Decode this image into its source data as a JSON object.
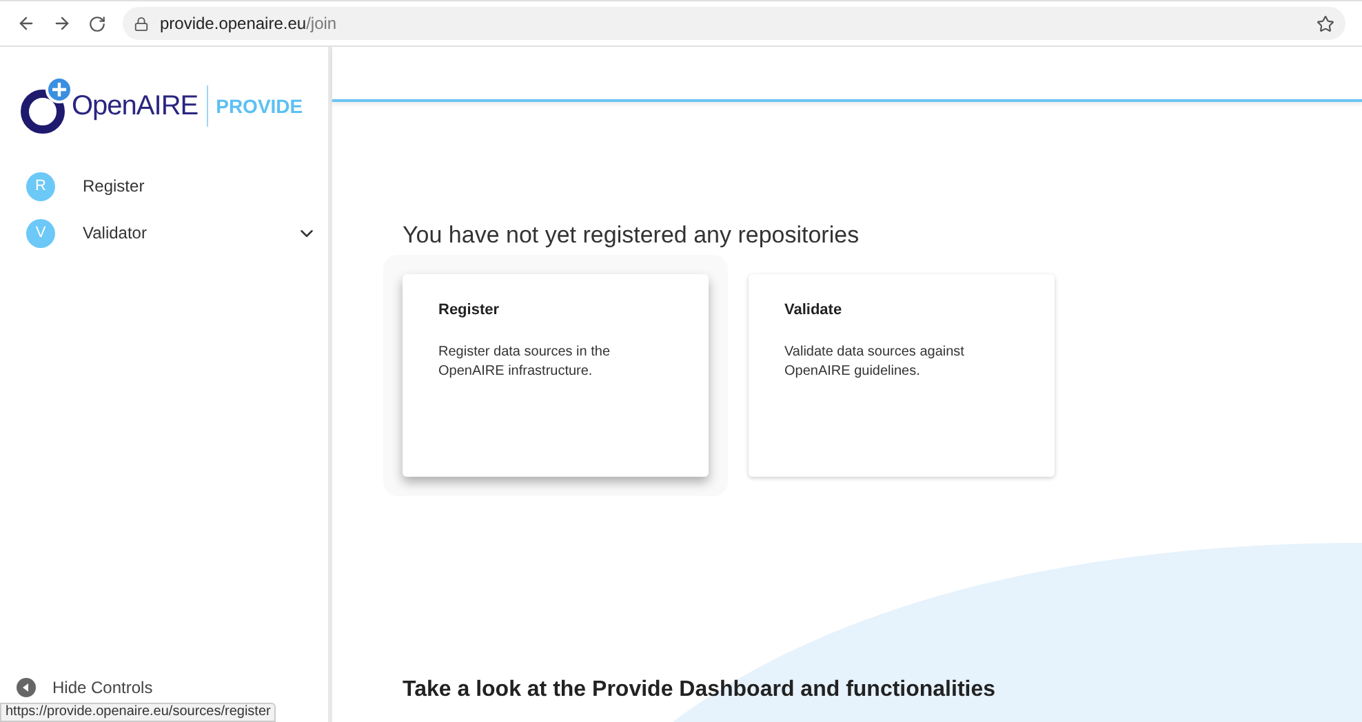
{
  "browser": {
    "url_host": "provide.openaire.eu",
    "url_path": "/join"
  },
  "logo": {
    "name": "OpenAIRE",
    "product": "PROVIDE"
  },
  "sidebar": {
    "items": [
      {
        "letter": "R",
        "label": "Register"
      },
      {
        "letter": "V",
        "label": "Validator",
        "expanded": false
      }
    ],
    "hide_controls": "Hide Controls"
  },
  "main": {
    "heading": "You have not yet registered any repositories",
    "cards": [
      {
        "title": "Register",
        "text": "Register data sources in the OpenAIRE infrastructure.",
        "hovered": true
      },
      {
        "title": "Validate",
        "text": "Validate data sources against OpenAIRE guidelines.",
        "hovered": false
      }
    ],
    "section_heading": "Take a look at the Provide Dashboard and functionalities"
  },
  "status_url": "https://provide.openaire.eu/sources/register"
}
